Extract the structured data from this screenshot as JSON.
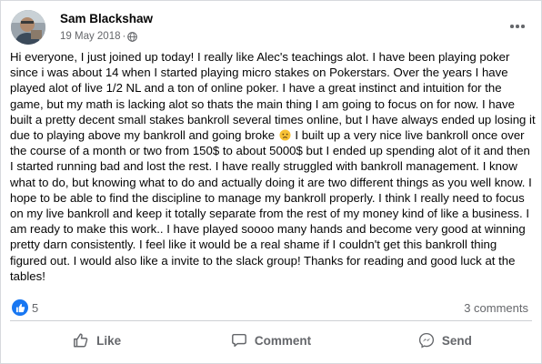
{
  "post": {
    "author": "Sam Blackshaw",
    "date": "19 May 2018",
    "separator": "·",
    "privacy_icon": "globe-icon",
    "text_part1": "Hi everyone, I just joined up today! I really like Alec's teachings alot. I have been playing poker since i was about 14 when I started playing micro stakes on Pokerstars. Over the years I have played alot of live 1/2 NL and a ton of online poker. I have a great instinct and intuition for the game, but my math is lacking alot so thats the main thing I am going to focus on for now. I have built a pretty decent small stakes bankroll several times online, but I have always ended up losing it due to playing above my bankroll and going broke",
    "emoji": "disappointed-face-emoji",
    "text_part2": " I built up a very nice live bankroll once over the course of a month or two from 150$ to about 5000$ but I ended up spending alot of it and then I started running bad and lost the rest. I have really struggled with bankroll management. I know what to do, but knowing what to do and actually doing it are two different things as you well know. I hope to be able to find the discipline to manage my bankroll properly. I think I really need to focus on my live bankroll and keep it totally separate from the rest of my money kind of like a business. I am ready to make this work.. I have played soooo many hands and become very good at winning pretty darn consistently. I feel like it would be a real shame if I couldn't get this bankroll thing figured out. I would also like a invite to the slack group! Thanks for reading and good luck at the tables!"
  },
  "stats": {
    "like_count": "5",
    "comments": "3 comments"
  },
  "actions": {
    "like": "Like",
    "comment": "Comment",
    "send": "Send"
  },
  "colors": {
    "accent": "#1877f2",
    "secondary_text": "#65676b",
    "divider": "#ced0d4"
  }
}
